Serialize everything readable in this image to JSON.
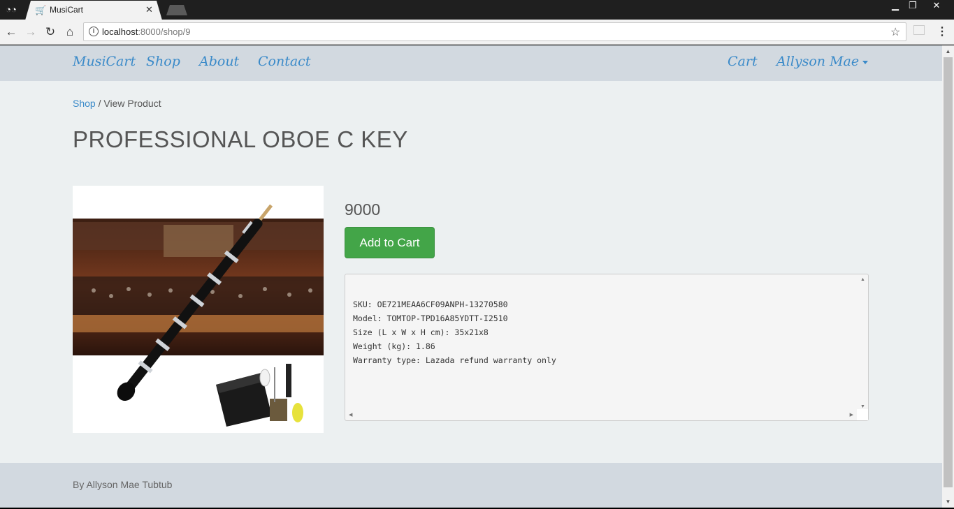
{
  "browser": {
    "tab_title": "MusiCart",
    "url_host": "localhost",
    "url_path": ":8000/shop/9"
  },
  "nav": {
    "brand": "MusiCart",
    "links": [
      "Shop",
      "About",
      "Contact"
    ],
    "cart": "Cart",
    "user": "Allyson Mae"
  },
  "breadcrumb": {
    "parent": "Shop",
    "separator": " / ",
    "current": "View Product"
  },
  "product": {
    "title": "PROFESSIONAL OBOE C KEY",
    "price": "9000",
    "add_to_cart_label": "Add to Cart",
    "details": "SKU: OE721MEAA6CF09ANPH-13270580\nModel: TOMTOP-TPD16A85YDTT-I2510\nSize (L x W x H cm): 35x21x8\nWeight (kg): 1.86\nWarranty type: Lazada refund warranty only"
  },
  "footer": {
    "text": "By Allyson Mae Tubtub"
  },
  "colors": {
    "link": "#3a8ac9",
    "navbar_bg": "#d2d9e0",
    "page_bg": "#ecf0f1",
    "button_green": "#43a548"
  }
}
